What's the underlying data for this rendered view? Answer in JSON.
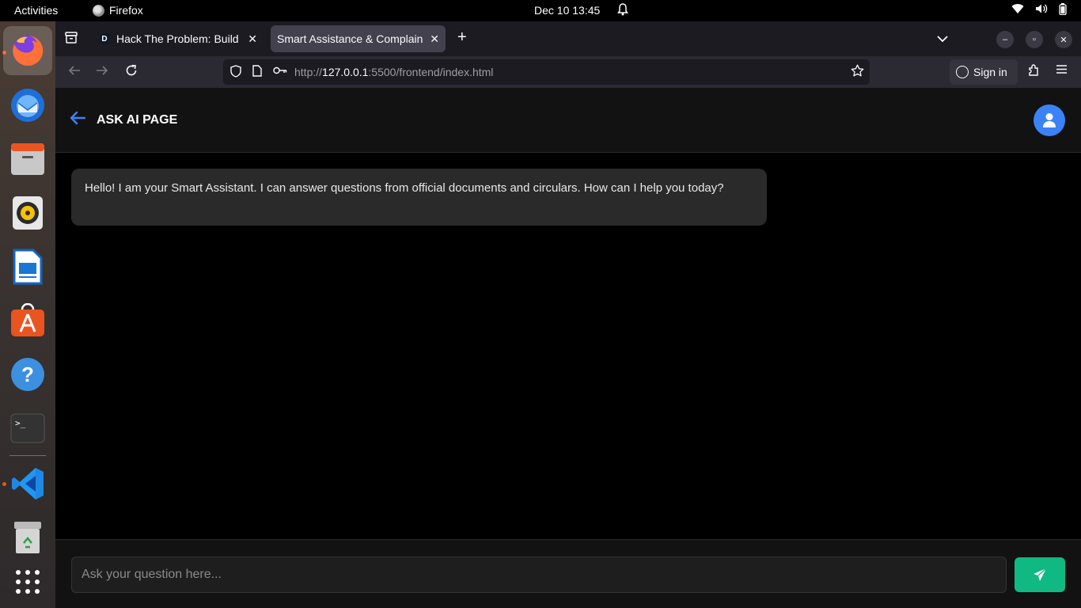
{
  "system": {
    "activities": "Activities",
    "app_name": "Firefox",
    "clock": "Dec 10  13:45"
  },
  "dock": {
    "items": [
      "firefox-icon",
      "thunderbird-icon",
      "files-icon",
      "rhythmbox-icon",
      "writer-icon",
      "app-center-icon",
      "help-icon",
      "terminal-icon",
      "vscode-icon",
      "trash-icon",
      "show-apps-icon"
    ]
  },
  "browser": {
    "tabs": [
      {
        "favicon": "D",
        "label": "Hack The Problem: Build"
      },
      {
        "label": "Smart Assistance & Complain"
      }
    ],
    "url_prefix": "http://",
    "url_host": "127.0.0.1",
    "url_rest": ":5500/frontend/index.html",
    "sign_in": "Sign in"
  },
  "page": {
    "title": "ASK AI PAGE",
    "messages": [
      {
        "role": "assistant",
        "text": "Hello! I am your Smart Assistant. I can answer questions from official documents and circulars. How can I help you today?"
      }
    ],
    "input_placeholder": "Ask your question here...",
    "colors": {
      "accent": "#3b82f6",
      "send": "#10b981"
    }
  }
}
